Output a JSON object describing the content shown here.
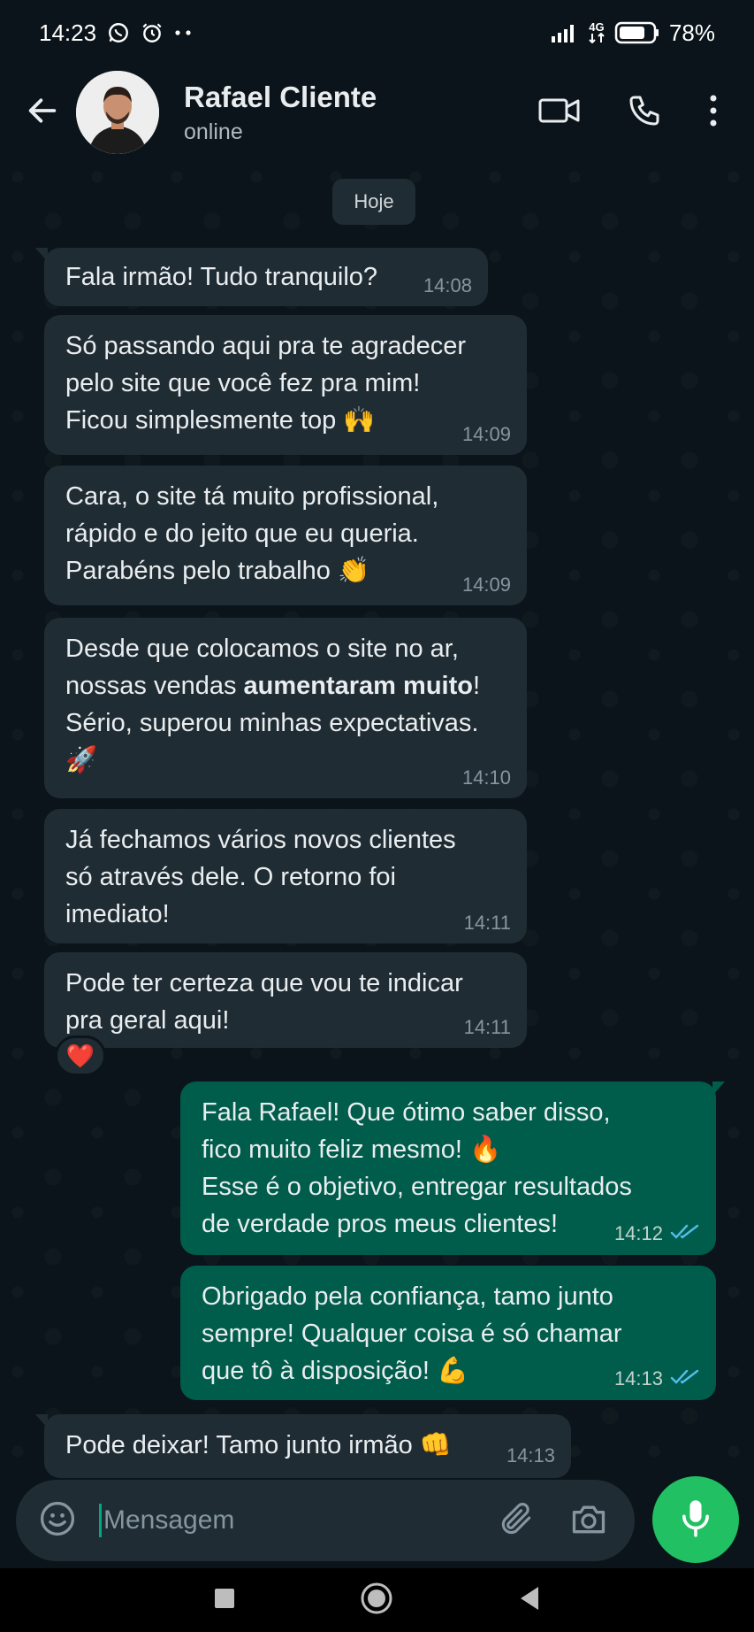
{
  "status_bar": {
    "time": "14:23",
    "network": "4G",
    "battery": "78%"
  },
  "header": {
    "contact_name": "Rafael Cliente",
    "contact_status": "online"
  },
  "chat": {
    "date_label": "Hoje",
    "messages": [
      {
        "direction": "in",
        "text": "Fala irmão! Tudo tranquilo?",
        "time": "14:08"
      },
      {
        "direction": "in",
        "text": "Só passando aqui pra te agradecer\npelo site que você fez pra mim!\nFicou simplesmente top 🙌",
        "time": "14:09"
      },
      {
        "direction": "in",
        "text": "Cara, o site tá muito profissional,\nrápido e do jeito que eu queria.\nParabéns pelo trabalho 👏",
        "time": "14:09"
      },
      {
        "direction": "in",
        "text_before": "Desde que colocamos o site no ar,\nnossas vendas ",
        "text_bold": "aumentaram muito",
        "text_after": "!\nSério, superou minhas expectativas.\n🚀",
        "time": "14:10"
      },
      {
        "direction": "in",
        "text": "Já fechamos vários novos clientes\nsó através dele. O retorno foi\nimediato!",
        "time": "14:11"
      },
      {
        "direction": "in",
        "text": "Pode ter certeza que vou te indicar\npra geral aqui!",
        "time": "14:11",
        "reaction": "❤️"
      },
      {
        "direction": "out",
        "text": "Fala Rafael! Que ótimo saber disso,\nfico muito feliz mesmo! 🔥\nEsse é o objetivo, entregar resultados\nde verdade pros meus clientes!",
        "time": "14:12",
        "status": "read"
      },
      {
        "direction": "out",
        "text": "Obrigado pela confiança, tamo junto\nsempre! Qualquer coisa é só chamar\nque tô à disposição! 💪",
        "time": "14:13",
        "status": "read"
      },
      {
        "direction": "in",
        "text": "Pode deixar! Tamo junto irmão 👊",
        "time": "14:13"
      }
    ]
  },
  "composer": {
    "placeholder": "Mensagem",
    "value": ""
  },
  "colors": {
    "background": "#0b141a",
    "incoming_bubble": "#202c33",
    "outgoing_bubble": "#005c4b",
    "accent": "#21c063",
    "read_ticks": "#53bdeb"
  },
  "icons": [
    "arrow-back-icon",
    "video-call-icon",
    "phone-icon",
    "more-vertical-icon",
    "emoji-icon",
    "attach-icon",
    "camera-icon",
    "mic-icon"
  ]
}
